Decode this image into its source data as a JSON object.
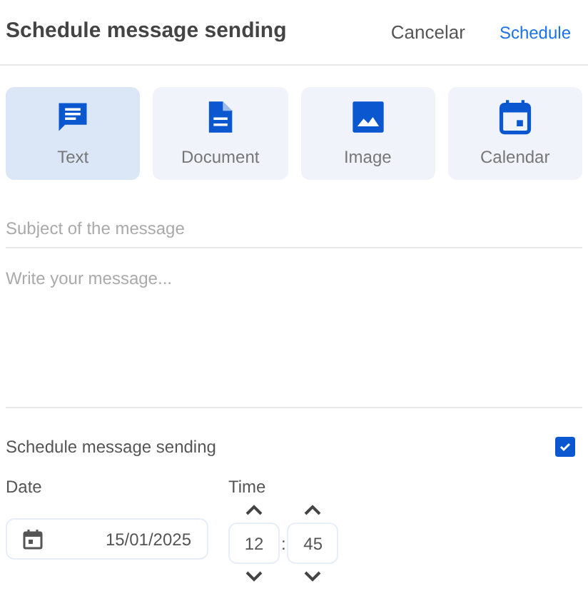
{
  "header": {
    "title": "Schedule message sending",
    "cancel": "Cancelar",
    "confirm": "Schedule"
  },
  "types": [
    {
      "kind": "text",
      "label": "Text",
      "selected": true
    },
    {
      "kind": "document",
      "label": "Document",
      "selected": false
    },
    {
      "kind": "image",
      "label": "Image",
      "selected": false
    },
    {
      "kind": "calendar",
      "label": "Calendar",
      "selected": false
    }
  ],
  "subject": {
    "placeholder": "Subject of the message"
  },
  "message": {
    "placeholder": "Write your message..."
  },
  "schedule": {
    "label": "Schedule message sending",
    "checked": true
  },
  "date": {
    "label": "Date",
    "value": "15/01/2025"
  },
  "time": {
    "label": "Time",
    "hours": "12",
    "separator": ":",
    "minutes": "45"
  }
}
